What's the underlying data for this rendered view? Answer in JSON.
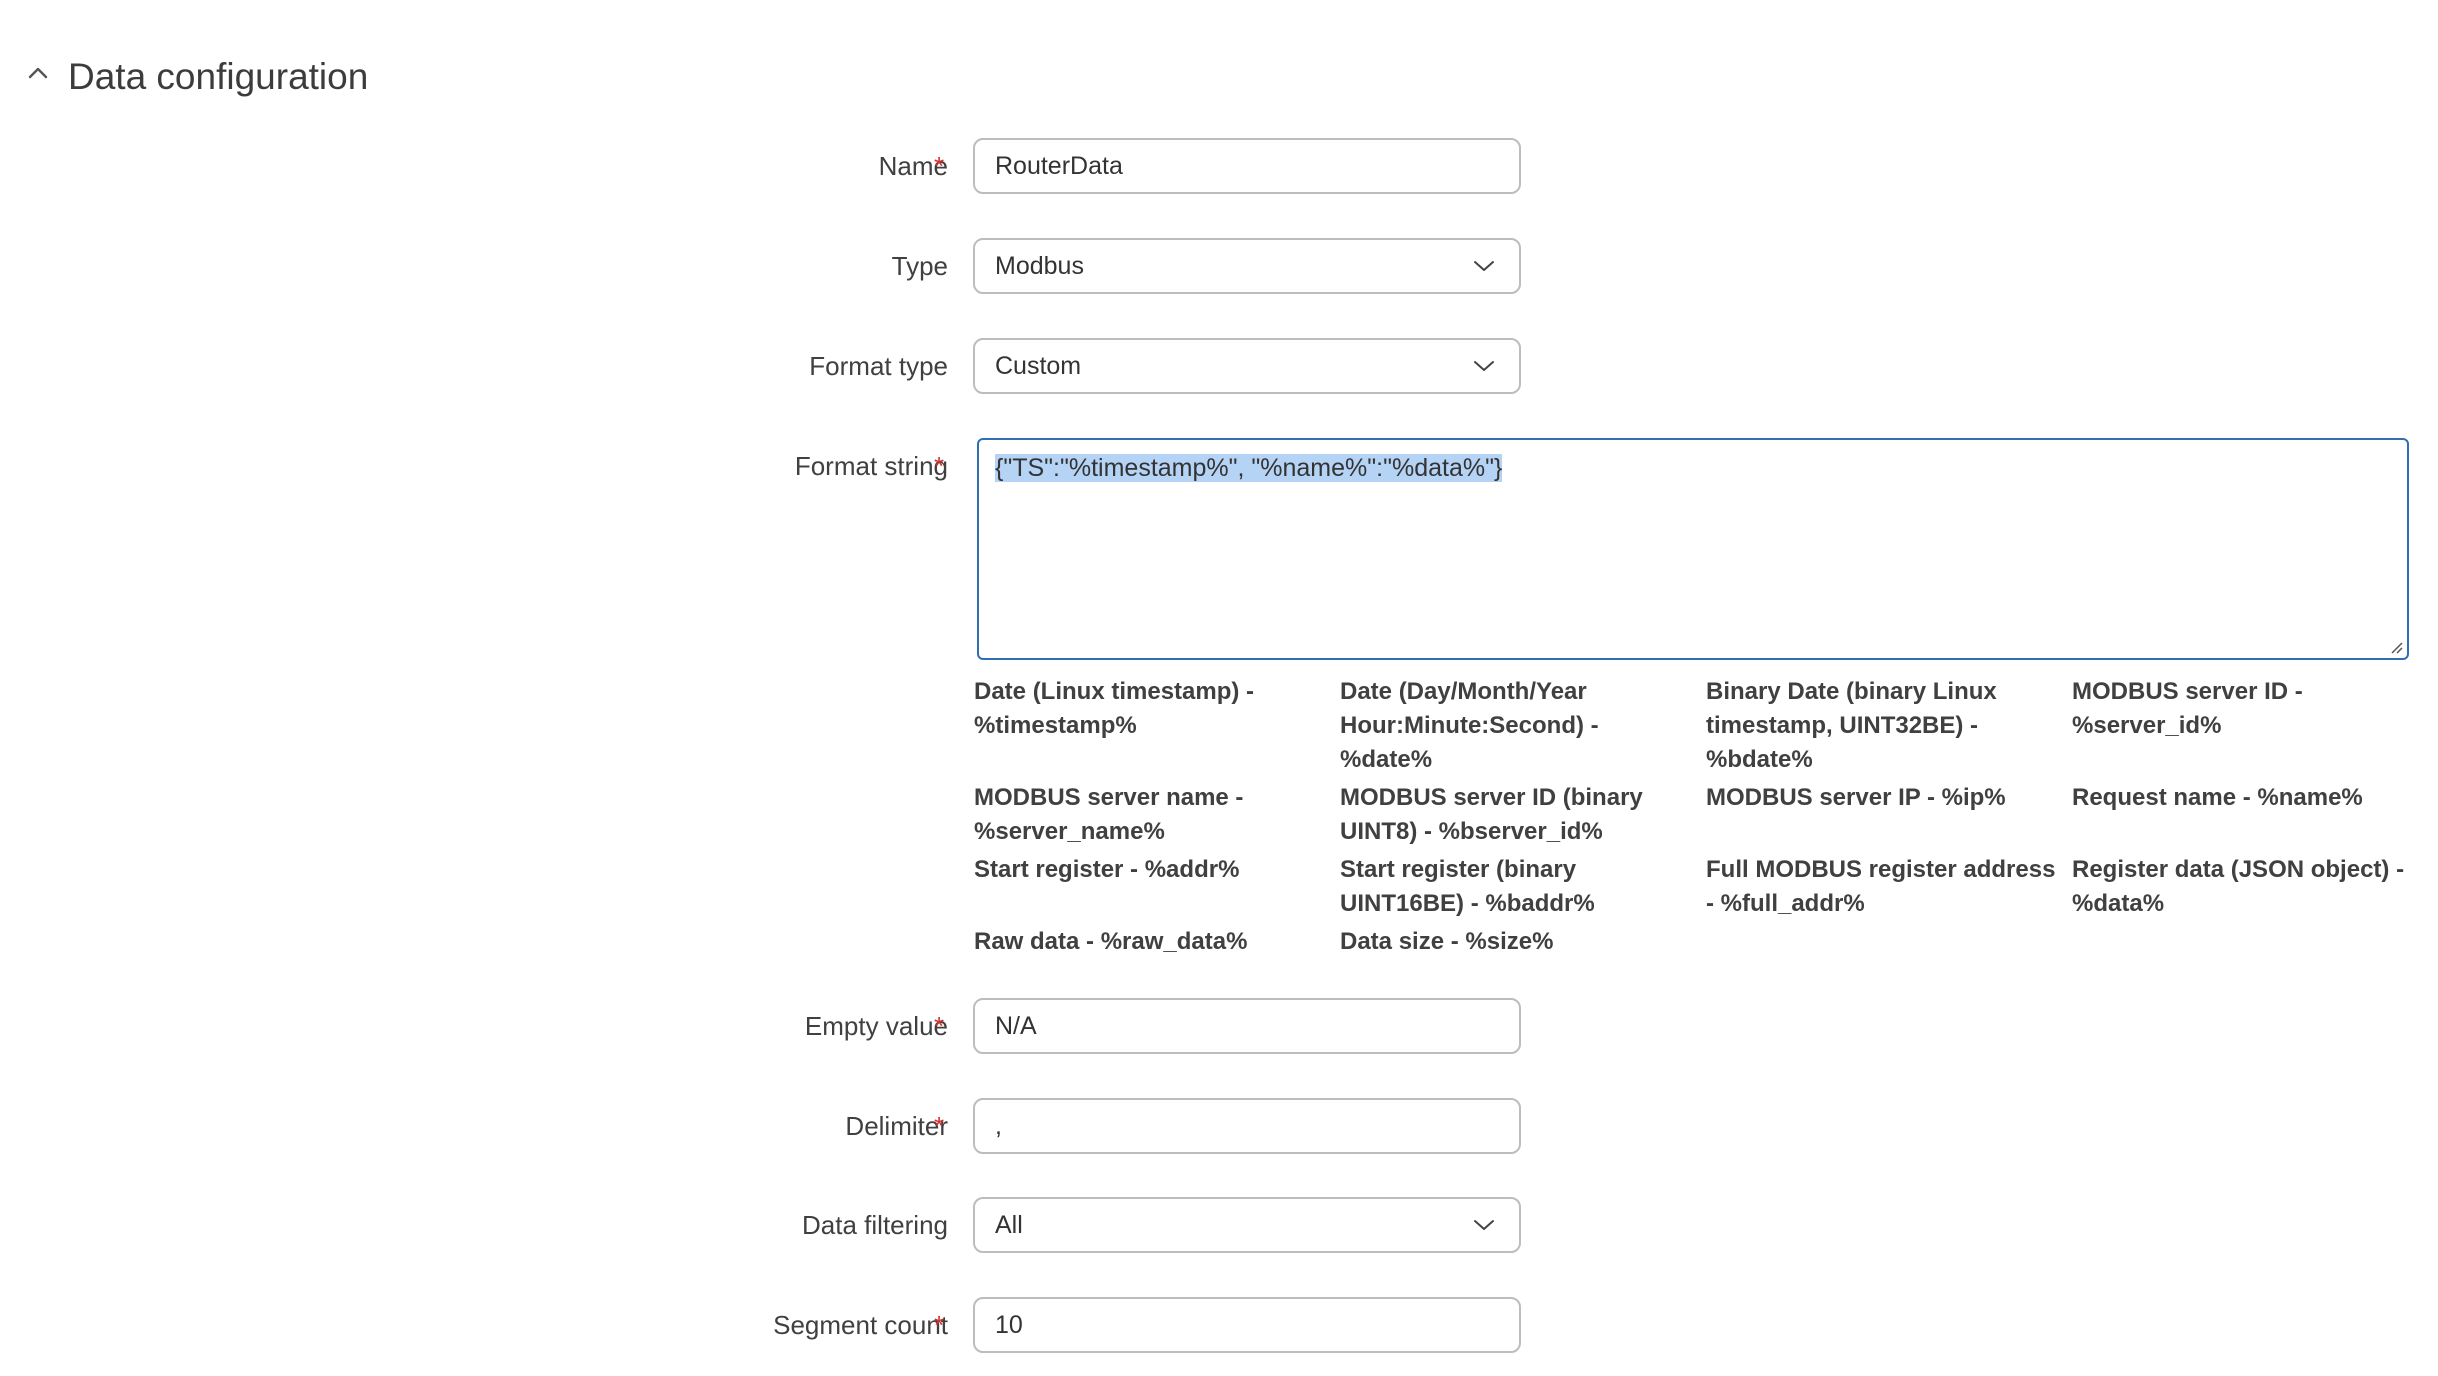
{
  "section": {
    "title": "Data configuration",
    "collapse_icon": "chevron-up-icon"
  },
  "fields": {
    "name": {
      "label": "Name",
      "required_mark": "*",
      "value": "RouterData"
    },
    "type": {
      "label": "Type",
      "value": "Modbus"
    },
    "format_type": {
      "label": "Format type",
      "value": "Custom"
    },
    "format_string": {
      "label": "Format string",
      "required_mark": "*",
      "value": "{\"TS\":\"%timestamp%\", \"%name%\":\"%data%\"}"
    },
    "empty_value": {
      "label": "Empty value",
      "required_mark": "*",
      "value": "N/A"
    },
    "delimiter": {
      "label": "Delimiter",
      "required_mark": "*",
      "value": ","
    },
    "data_filtering": {
      "label": "Data filtering",
      "value": "All"
    },
    "segment_count": {
      "label": "Segment count",
      "required_mark": "*",
      "value": "10"
    }
  },
  "help_items": [
    "Date (Linux timestamp) - %timestamp%",
    "Date (Day/Month/Year Hour:Minute:Second) - %date%",
    "Binary Date (binary Linux timestamp, UINT32BE) - %bdate%",
    "MODBUS server ID - %server_id%",
    "MODBUS server name - %server_name%",
    "MODBUS server ID (binary UINT8) - %bserver_id%",
    "MODBUS server IP - %ip%",
    "Request name - %name%",
    "Start register - %addr%",
    "Start register (binary UINT16BE) - %baddr%",
    "Full MODBUS register address - %full_addr%",
    "Register data (JSON object) - %data%",
    "Raw data - %raw_data%",
    "Data size - %size%"
  ]
}
